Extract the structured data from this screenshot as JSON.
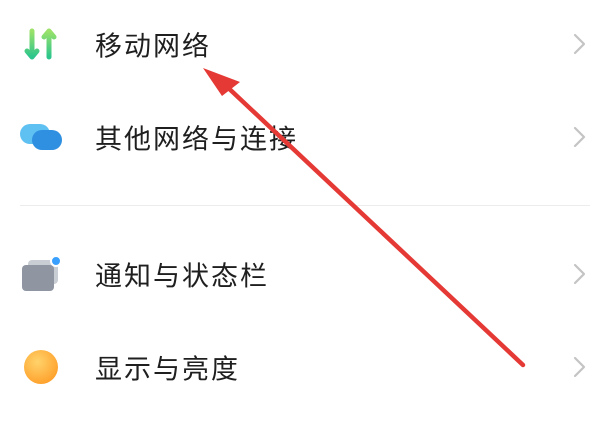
{
  "settings": {
    "items": [
      {
        "label": "移动网络",
        "icon": "mobile-data-arrows-icon"
      },
      {
        "label": "其他网络与连接",
        "icon": "connection-bubbles-icon"
      },
      {
        "label": "通知与状态栏",
        "icon": "notification-card-icon"
      },
      {
        "label": "显示与亮度",
        "icon": "brightness-sun-icon"
      }
    ],
    "chevron_icon": "chevron-right-icon"
  },
  "annotation": {
    "type": "red-arrow",
    "color": "#e53935",
    "points_to": "移动网络"
  },
  "colors": {
    "mobile_icon": "#3ccf8e",
    "connection_icon": "#2f8fe0",
    "notification_icon": "#9aa0aa",
    "notification_dot": "#3aa0ff",
    "brightness_icon": "#ffa534",
    "chevron": "#c4c4c4"
  }
}
